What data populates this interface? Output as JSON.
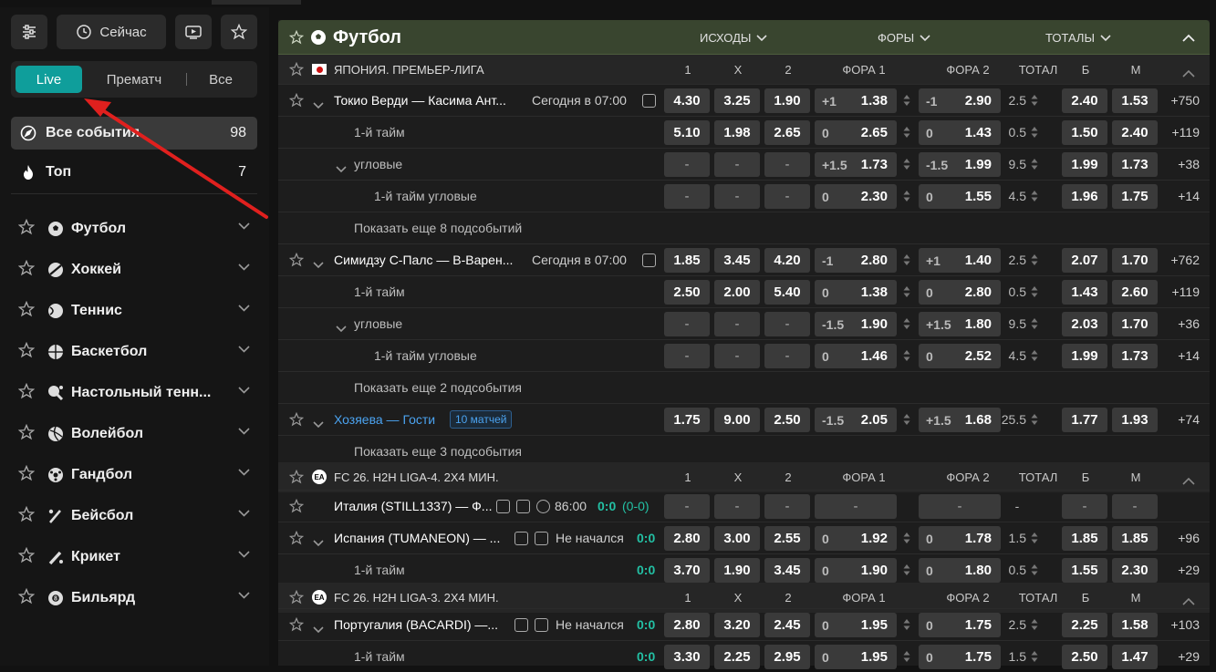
{
  "sidebar": {
    "now_label": "Сейчас",
    "filter": {
      "live": "Live",
      "prematch": "Прематч",
      "all": "Все"
    },
    "items": [
      {
        "label": "Все события",
        "count": "98"
      },
      {
        "label": "Топ",
        "count": "7"
      }
    ],
    "sports": [
      {
        "label": "Футбол"
      },
      {
        "label": "Хоккей"
      },
      {
        "label": "Теннис"
      },
      {
        "label": "Баскетбол"
      },
      {
        "label": "Настольный тенн..."
      },
      {
        "label": "Волейбол"
      },
      {
        "label": "Гандбол"
      },
      {
        "label": "Бейсбол"
      },
      {
        "label": "Крикет"
      },
      {
        "label": "Бильярд"
      }
    ]
  },
  "main": {
    "title": "Футбол",
    "tabs": {
      "outcomes": "ИСХОДЫ",
      "handicaps": "ФОРЫ",
      "totals": "ТОТАЛЫ"
    },
    "cols": {
      "c1": "1",
      "cx": "X",
      "c2": "2",
      "f1": "ФОРА 1",
      "f2": "ФОРА 2",
      "total": "ТОТАЛ",
      "over": "Б",
      "under": "М"
    },
    "leagues": [
      {
        "name": "ЯПОНИЯ. ПРЕМЬЕР-ЛИГА"
      },
      {
        "name": "FC 26. H2H LIGA-4. 2X4 МИН."
      },
      {
        "name": "FC 26. H2H LIGA-3. 2X4 МИН."
      }
    ],
    "rows": [
      {
        "name": "Токио Верди — Касима Ант...",
        "time": "Сегодня в 07:00",
        "o1": "4.30",
        "ox": "3.25",
        "o2": "1.90",
        "h1": "+1",
        "h1o": "1.38",
        "h2": "-1",
        "h2o": "2.90",
        "t": "2.5",
        "b": "2.40",
        "m": "1.53",
        "more": "+750"
      },
      {
        "name": "1-й тайм",
        "o1": "5.10",
        "ox": "1.98",
        "o2": "2.65",
        "h1": "0",
        "h1o": "2.65",
        "h2": "0",
        "h2o": "1.43",
        "t": "0.5",
        "b": "1.50",
        "m": "2.40",
        "more": "+119"
      },
      {
        "name": "угловые",
        "o1": "-",
        "ox": "-",
        "o2": "-",
        "h1": "+1.5",
        "h1o": "1.73",
        "h2": "-1.5",
        "h2o": "1.99",
        "t": "9.5",
        "b": "1.99",
        "m": "1.73",
        "more": "+38"
      },
      {
        "name": "1-й тайм угловые",
        "o1": "-",
        "ox": "-",
        "o2": "-",
        "h1": "0",
        "h1o": "2.30",
        "h2": "0",
        "h2o": "1.55",
        "t": "4.5",
        "b": "1.96",
        "m": "1.75",
        "more": "+14"
      },
      {
        "name": "Показать еще 8 подсобытий"
      },
      {
        "name": "Симидзу С-Палс — В-Варен...",
        "time": "Сегодня в 07:00",
        "o1": "1.85",
        "ox": "3.45",
        "o2": "4.20",
        "h1": "-1",
        "h1o": "2.80",
        "h2": "+1",
        "h2o": "1.40",
        "t": "2.5",
        "b": "2.07",
        "m": "1.70",
        "more": "+762"
      },
      {
        "name": "1-й тайм",
        "o1": "2.50",
        "ox": "2.00",
        "o2": "5.40",
        "h1": "0",
        "h1o": "1.38",
        "h2": "0",
        "h2o": "2.80",
        "t": "0.5",
        "b": "1.43",
        "m": "2.60",
        "more": "+119"
      },
      {
        "name": "угловые",
        "o1": "-",
        "ox": "-",
        "o2": "-",
        "h1": "-1.5",
        "h1o": "1.90",
        "h2": "+1.5",
        "h2o": "1.80",
        "t": "9.5",
        "b": "2.03",
        "m": "1.70",
        "more": "+36"
      },
      {
        "name": "1-й тайм угловые",
        "o1": "-",
        "ox": "-",
        "o2": "-",
        "h1": "0",
        "h1o": "1.46",
        "h2": "0",
        "h2o": "2.52",
        "t": "4.5",
        "b": "1.99",
        "m": "1.73",
        "more": "+14"
      },
      {
        "name": "Показать еще 2 подсобытия"
      },
      {
        "name": "Хозяева — Гости",
        "badge": "10 матчей",
        "o1": "1.75",
        "ox": "9.00",
        "o2": "2.50",
        "h1": "-1.5",
        "h1o": "2.05",
        "h2": "+1.5",
        "h2o": "1.68",
        "t": "25.5",
        "b": "1.77",
        "m": "1.93",
        "more": "+74"
      },
      {
        "name": "Показать еще 3 подсобытия"
      },
      {
        "name": "Италия (STILL1337) — Ф...",
        "time": "86:00",
        "score": "0:0",
        "score2": "(0-0)",
        "o1": "-",
        "ox": "-",
        "o2": "-",
        "h": "-",
        "h2x": "-",
        "t": "-",
        "b": "-",
        "m": "-"
      },
      {
        "name": "Испания (TUMANEON) — ...",
        "time": "Не начался",
        "score": "0:0",
        "o1": "2.80",
        "ox": "3.00",
        "o2": "2.55",
        "h1": "0",
        "h1o": "1.92",
        "h2": "0",
        "h2o": "1.78",
        "t": "1.5",
        "b": "1.85",
        "m": "1.85",
        "more": "+96"
      },
      {
        "name": "1-й тайм",
        "score": "0:0",
        "o1": "3.70",
        "ox": "1.90",
        "o2": "3.45",
        "h1": "0",
        "h1o": "1.90",
        "h2": "0",
        "h2o": "1.80",
        "t": "0.5",
        "b": "1.55",
        "m": "2.30",
        "more": "+29"
      },
      {
        "name": "Португалия (BACARDI) —...",
        "time": "Не начался",
        "score": "0:0",
        "o1": "2.80",
        "ox": "3.20",
        "o2": "2.45",
        "h1": "0",
        "h1o": "1.95",
        "h2": "0",
        "h2o": "1.75",
        "t": "2.5",
        "b": "2.25",
        "m": "1.58",
        "more": "+103"
      },
      {
        "name": "1-й тайм",
        "score": "0:0",
        "o1": "3.30",
        "ox": "2.25",
        "o2": "2.95",
        "h1": "0",
        "h1o": "1.95",
        "h2": "0",
        "h2o": "1.75",
        "t": "1.5",
        "b": "2.50",
        "m": "1.47",
        "more": "+29"
      }
    ]
  },
  "colors": {
    "accent": "#0f9e9b",
    "sport_header": "#39452f",
    "score": "#23c0a4",
    "annotation_arrow": "#e0201e"
  }
}
